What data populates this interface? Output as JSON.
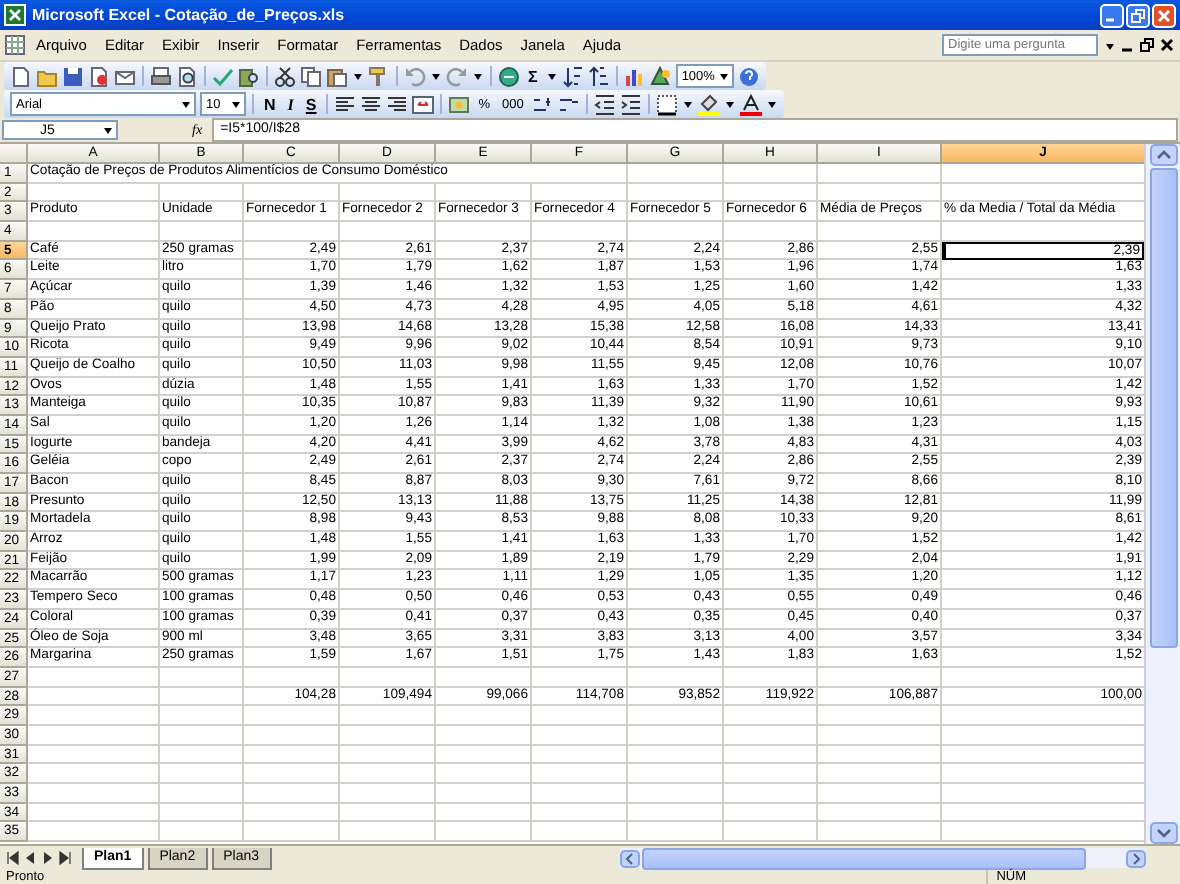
{
  "window": {
    "title": "Microsoft Excel - Cotação_de_Preços.xls"
  },
  "menu": {
    "items": [
      "Arquivo",
      "Editar",
      "Exibir",
      "Inserir",
      "Formatar",
      "Ferramentas",
      "Dados",
      "Janela",
      "Ajuda"
    ],
    "help_box": {
      "placeholder": "Digite uma pergunta"
    }
  },
  "standard_toolbar": {
    "autosum": "Σ",
    "zoom": "100%"
  },
  "formatting_toolbar": {
    "font": "Arial",
    "size": "10",
    "style_buttons": [
      "N",
      "I",
      "S"
    ],
    "number_buttons": [
      "%",
      "000"
    ]
  },
  "formula_bar": {
    "name_box": "J5",
    "fx": "fx",
    "formula": "=I5*100/I$28"
  },
  "sheet": {
    "columns": [
      {
        "letter": "A",
        "selected": false
      },
      {
        "letter": "B",
        "selected": false
      },
      {
        "letter": "C",
        "selected": false
      },
      {
        "letter": "D",
        "selected": false
      },
      {
        "letter": "E",
        "selected": false
      },
      {
        "letter": "F",
        "selected": false
      },
      {
        "letter": "G",
        "selected": false
      },
      {
        "letter": "H",
        "selected": false
      },
      {
        "letter": "I",
        "selected": false
      },
      {
        "letter": "J",
        "selected": true
      }
    ],
    "rows": [
      {
        "number": "1",
        "selected": false,
        "kind": "title",
        "cells": {
          "A": "Cotação de Preços de Produtos Alimentícios de Consumo Doméstico"
        }
      },
      {
        "number": "2",
        "selected": false,
        "kind": "blank"
      },
      {
        "number": "3",
        "selected": false,
        "kind": "header",
        "cells": {
          "A": "Produto",
          "B": "Unidade",
          "C": "Fornecedor 1",
          "D": "Fornecedor 2",
          "E": "Fornecedor 3",
          "F": "Fornecedor 4",
          "G": "Fornecedor 5",
          "H": "Fornecedor 6",
          "I": "Média de Preços",
          "J": "% da Media / Total da Média"
        }
      },
      {
        "number": "4",
        "selected": false,
        "kind": "blank"
      },
      {
        "number": "5",
        "selected": true,
        "kind": "item",
        "cells": {
          "A": "Café",
          "B": "250 gramas",
          "C": "2,49",
          "D": "2,61",
          "E": "2,37",
          "F": "2,74",
          "G": "2,24",
          "H": "2,86",
          "I": "2,55",
          "J": "2,39"
        }
      },
      {
        "number": "6",
        "selected": false,
        "kind": "item",
        "cells": {
          "A": "Leite",
          "B": "litro",
          "C": "1,70",
          "D": "1,79",
          "E": "1,62",
          "F": "1,87",
          "G": "1,53",
          "H": "1,96",
          "I": "1,74",
          "J": "1,63"
        }
      },
      {
        "number": "7",
        "selected": false,
        "kind": "item",
        "cells": {
          "A": "Açúcar",
          "B": "quilo",
          "C": "1,39",
          "D": "1,46",
          "E": "1,32",
          "F": "1,53",
          "G": "1,25",
          "H": "1,60",
          "I": "1,42",
          "J": "1,33"
        }
      },
      {
        "number": "8",
        "selected": false,
        "kind": "item",
        "cells": {
          "A": "Pão",
          "B": "quilo",
          "C": "4,50",
          "D": "4,73",
          "E": "4,28",
          "F": "4,95",
          "G": "4,05",
          "H": "5,18",
          "I": "4,61",
          "J": "4,32"
        }
      },
      {
        "number": "9",
        "selected": false,
        "kind": "item",
        "cells": {
          "A": "Queijo Prato",
          "B": "quilo",
          "C": "13,98",
          "D": "14,68",
          "E": "13,28",
          "F": "15,38",
          "G": "12,58",
          "H": "16,08",
          "I": "14,33",
          "J": "13,41"
        }
      },
      {
        "number": "10",
        "selected": false,
        "kind": "item",
        "cells": {
          "A": "Ricota",
          "B": "quilo",
          "C": "9,49",
          "D": "9,96",
          "E": "9,02",
          "F": "10,44",
          "G": "8,54",
          "H": "10,91",
          "I": "9,73",
          "J": "9,10"
        }
      },
      {
        "number": "11",
        "selected": false,
        "kind": "item",
        "cells": {
          "A": "Queijo de Coalho",
          "B": "quilo",
          "C": "10,50",
          "D": "11,03",
          "E": "9,98",
          "F": "11,55",
          "G": "9,45",
          "H": "12,08",
          "I": "10,76",
          "J": "10,07"
        }
      },
      {
        "number": "12",
        "selected": false,
        "kind": "item",
        "cells": {
          "A": "Ovos",
          "B": "dúzia",
          "C": "1,48",
          "D": "1,55",
          "E": "1,41",
          "F": "1,63",
          "G": "1,33",
          "H": "1,70",
          "I": "1,52",
          "J": "1,42"
        }
      },
      {
        "number": "13",
        "selected": false,
        "kind": "item",
        "cells": {
          "A": "Manteiga",
          "B": "quilo",
          "C": "10,35",
          "D": "10,87",
          "E": "9,83",
          "F": "11,39",
          "G": "9,32",
          "H": "11,90",
          "I": "10,61",
          "J": "9,93"
        }
      },
      {
        "number": "14",
        "selected": false,
        "kind": "item",
        "cells": {
          "A": "Sal",
          "B": "quilo",
          "C": "1,20",
          "D": "1,26",
          "E": "1,14",
          "F": "1,32",
          "G": "1,08",
          "H": "1,38",
          "I": "1,23",
          "J": "1,15"
        }
      },
      {
        "number": "15",
        "selected": false,
        "kind": "item",
        "cells": {
          "A": "Iogurte",
          "B": "bandeja",
          "C": "4,20",
          "D": "4,41",
          "E": "3,99",
          "F": "4,62",
          "G": "3,78",
          "H": "4,83",
          "I": "4,31",
          "J": "4,03"
        }
      },
      {
        "number": "16",
        "selected": false,
        "kind": "item",
        "cells": {
          "A": "Geléia",
          "B": "copo",
          "C": "2,49",
          "D": "2,61",
          "E": "2,37",
          "F": "2,74",
          "G": "2,24",
          "H": "2,86",
          "I": "2,55",
          "J": "2,39"
        }
      },
      {
        "number": "17",
        "selected": false,
        "kind": "item",
        "cells": {
          "A": "Bacon",
          "B": "quilo",
          "C": "8,45",
          "D": "8,87",
          "E": "8,03",
          "F": "9,30",
          "G": "7,61",
          "H": "9,72",
          "I": "8,66",
          "J": "8,10"
        }
      },
      {
        "number": "18",
        "selected": false,
        "kind": "item",
        "cells": {
          "A": "Presunto",
          "B": "quilo",
          "C": "12,50",
          "D": "13,13",
          "E": "11,88",
          "F": "13,75",
          "G": "11,25",
          "H": "14,38",
          "I": "12,81",
          "J": "11,99"
        }
      },
      {
        "number": "19",
        "selected": false,
        "kind": "item",
        "cells": {
          "A": "Mortadela",
          "B": "quilo",
          "C": "8,98",
          "D": "9,43",
          "E": "8,53",
          "F": "9,88",
          "G": "8,08",
          "H": "10,33",
          "I": "9,20",
          "J": "8,61"
        }
      },
      {
        "number": "20",
        "selected": false,
        "kind": "item",
        "cells": {
          "A": "Arroz",
          "B": "quilo",
          "C": "1,48",
          "D": "1,55",
          "E": "1,41",
          "F": "1,63",
          "G": "1,33",
          "H": "1,70",
          "I": "1,52",
          "J": "1,42"
        }
      },
      {
        "number": "21",
        "selected": false,
        "kind": "item",
        "cells": {
          "A": "Feijão",
          "B": "quilo",
          "C": "1,99",
          "D": "2,09",
          "E": "1,89",
          "F": "2,19",
          "G": "1,79",
          "H": "2,29",
          "I": "2,04",
          "J": "1,91"
        }
      },
      {
        "number": "22",
        "selected": false,
        "kind": "item",
        "cells": {
          "A": "Macarrão",
          "B": "500 gramas",
          "C": "1,17",
          "D": "1,23",
          "E": "1,11",
          "F": "1,29",
          "G": "1,05",
          "H": "1,35",
          "I": "1,20",
          "J": "1,12"
        }
      },
      {
        "number": "23",
        "selected": false,
        "kind": "item",
        "cells": {
          "A": "Tempero Seco",
          "B": "100 gramas",
          "C": "0,48",
          "D": "0,50",
          "E": "0,46",
          "F": "0,53",
          "G": "0,43",
          "H": "0,55",
          "I": "0,49",
          "J": "0,46"
        }
      },
      {
        "number": "24",
        "selected": false,
        "kind": "item",
        "cells": {
          "A": "Coloral",
          "B": "100 gramas",
          "C": "0,39",
          "D": "0,41",
          "E": "0,37",
          "F": "0,43",
          "G": "0,35",
          "H": "0,45",
          "I": "0,40",
          "J": "0,37"
        }
      },
      {
        "number": "25",
        "selected": false,
        "kind": "item",
        "cells": {
          "A": "Óleo de Soja",
          "B": "900 ml",
          "C": "3,48",
          "D": "3,65",
          "E": "3,31",
          "F": "3,83",
          "G": "3,13",
          "H": "4,00",
          "I": "3,57",
          "J": "3,34"
        }
      },
      {
        "number": "26",
        "selected": false,
        "kind": "item",
        "cells": {
          "A": "Margarina",
          "B": "250 gramas",
          "C": "1,59",
          "D": "1,67",
          "E": "1,51",
          "F": "1,75",
          "G": "1,43",
          "H": "1,83",
          "I": "1,63",
          "J": "1,52"
        }
      },
      {
        "number": "27",
        "selected": false,
        "kind": "blank"
      },
      {
        "number": "28",
        "selected": false,
        "kind": "item",
        "cells": {
          "C": "104,28",
          "D": "109,494",
          "E": "99,066",
          "F": "114,708",
          "G": "93,852",
          "H": "119,922",
          "I": "106,887",
          "J": "100,00"
        }
      },
      {
        "number": "29",
        "selected": false,
        "kind": "blank"
      },
      {
        "number": "30",
        "selected": false,
        "kind": "blank"
      },
      {
        "number": "31",
        "selected": false,
        "kind": "blank"
      },
      {
        "number": "32",
        "selected": false,
        "kind": "blank"
      },
      {
        "number": "33",
        "selected": false,
        "kind": "blank"
      },
      {
        "number": "34",
        "selected": false,
        "kind": "blank"
      },
      {
        "number": "35",
        "selected": false,
        "kind": "blank"
      }
    ]
  },
  "sheet_tabs": [
    {
      "label": "Plan1",
      "selected": true
    },
    {
      "label": "Plan2",
      "selected": false
    },
    {
      "label": "Plan3",
      "selected": false
    }
  ],
  "status_bar": {
    "status": "Pronto",
    "indicator": "NÚM"
  }
}
